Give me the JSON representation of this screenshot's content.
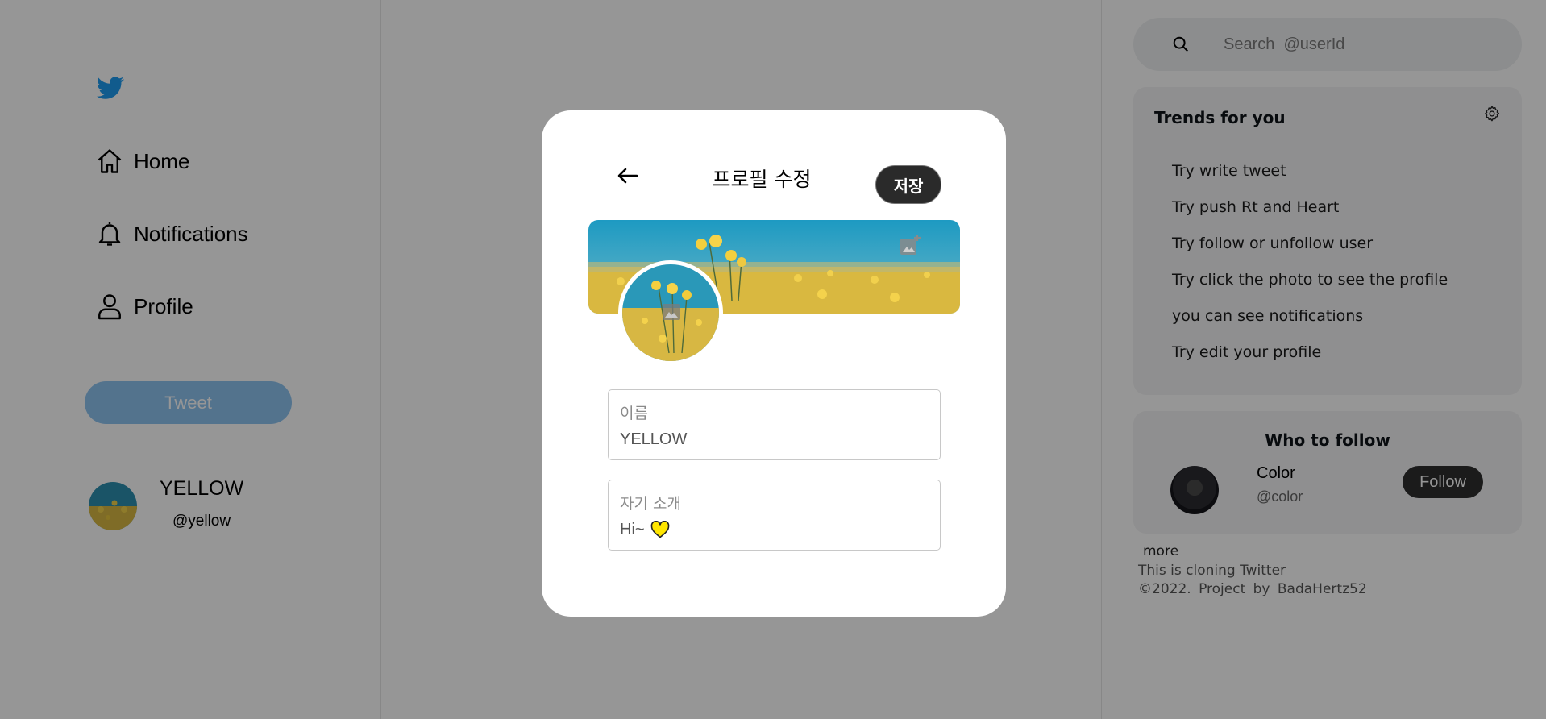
{
  "nav": {
    "home_label": "Home",
    "notifications_label": "Notifications",
    "profile_label": "Profile",
    "tweet_label": "Tweet"
  },
  "current_user": {
    "name": "YELLOW",
    "handle": "@yellow"
  },
  "search": {
    "placeholder": "Search  @userId"
  },
  "trends": {
    "title": "Trends for you",
    "items": [
      "Try write tweet",
      "Try push Rt and Heart",
      "Try follow or unfollow user",
      "Try click the photo to see the profile",
      "you can see notifications",
      "Try edit your profile"
    ]
  },
  "who_to_follow": {
    "title": "Who to follow",
    "user": {
      "name": "Color",
      "handle": "@color"
    },
    "follow_label": "Follow"
  },
  "footer": {
    "more": "more",
    "line1": "This is cloning Twitter",
    "line2": "©2022.  Project  by  BadaHertz52"
  },
  "modal": {
    "title": "프로필 수정",
    "save_label": "저장",
    "name_label": "이름",
    "name_value": "YELLOW",
    "bio_label": "자기 소개",
    "bio_value": "Hi~"
  },
  "icons": {
    "logo": "twitter-bird-icon",
    "home": "home-icon",
    "notifications": "bell-icon",
    "profile": "person-icon",
    "search": "search-icon",
    "settings": "gear-icon",
    "back": "arrow-left-icon",
    "add_photo": "add-photo-icon",
    "heart": "yellow-heart-icon"
  },
  "colors": {
    "brand": "#1d9bf0",
    "tweet_button": "#8ec3f0",
    "dark_button": "#2a2a2a",
    "overlay": "rgba(0,0,0,0.41)",
    "heart": "#ffe600"
  }
}
